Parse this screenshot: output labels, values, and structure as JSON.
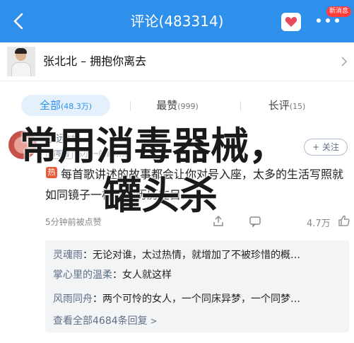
{
  "header": {
    "title": "评论(483314)",
    "badge": "新消息",
    "colors": {
      "bar": "#2f90ec",
      "badge": "#ff3d3d"
    }
  },
  "song": {
    "text": "张北北 – 拥抱你离去"
  },
  "tabs": [
    {
      "label": "全部",
      "count": "(48.3万)",
      "active": true
    },
    {
      "label": "最赞",
      "count": "(999)",
      "active": false
    },
    {
      "label": "长评",
      "count": "(15)",
      "active": false
    }
  ],
  "comment": {
    "username": "永远**?",
    "tag": "演唱者",
    "meta": "陈小一的歌听众",
    "follow_label": "+ 关注",
    "hot": "热",
    "text": "每首歌讲述的故事都会让你对号入座，太多的生活写照就如同镜子一样让你历历在目！",
    "time": "5分钟前被点赞",
    "likes": "4.7万"
  },
  "replies": [
    {
      "name": "灵魂雨",
      "text": "无论对谁，太过热情，就增加了不被珍惜的概…"
    },
    {
      "name": "掌心里的温柔",
      "text": "女人就这样"
    },
    {
      "name": "风雨同舟",
      "text": "两个可怜的女人，一个同床异梦，一个同梦…"
    }
  ],
  "view_all": "查看全部4684条回复",
  "overlay": {
    "line1": "常用消毒器械，",
    "line2": "罐头杀"
  }
}
